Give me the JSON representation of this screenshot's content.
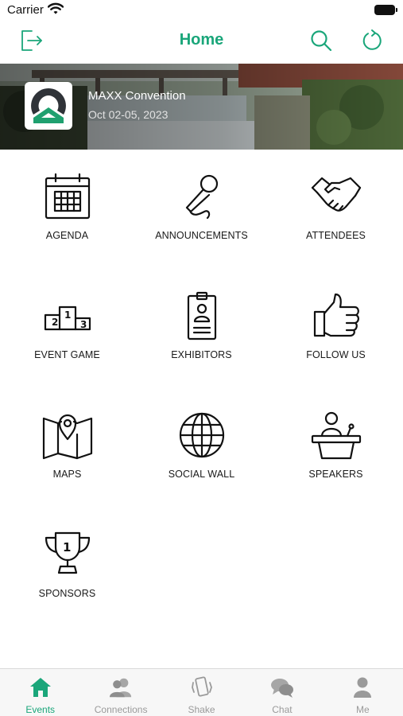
{
  "status_bar": {
    "carrier": "Carrier"
  },
  "nav": {
    "title": "Home"
  },
  "event": {
    "name": "MAXX Convention",
    "dates": "Oct 02-05, 2023"
  },
  "menu": [
    {
      "label": "AGENDA",
      "icon": "calendar-icon"
    },
    {
      "label": "ANNOUNCEMENTS",
      "icon": "microphone-icon"
    },
    {
      "label": "ATTENDEES",
      "icon": "handshake-icon"
    },
    {
      "label": "EVENT GAME",
      "icon": "podium-icon"
    },
    {
      "label": "EXHIBITORS",
      "icon": "badge-icon"
    },
    {
      "label": "FOLLOW US",
      "icon": "thumbs-up-icon"
    },
    {
      "label": "MAPS",
      "icon": "map-pin-icon"
    },
    {
      "label": "SOCIAL WALL",
      "icon": "globe-icon"
    },
    {
      "label": "SPEAKERS",
      "icon": "lectern-icon"
    },
    {
      "label": "SPONSORS",
      "icon": "trophy-icon"
    }
  ],
  "tabs": [
    {
      "label": "Events",
      "icon": "home-icon",
      "active": true
    },
    {
      "label": "Connections",
      "icon": "people-icon",
      "active": false
    },
    {
      "label": "Shake",
      "icon": "shake-phone-icon",
      "active": false
    },
    {
      "label": "Chat",
      "icon": "chat-bubbles-icon",
      "active": false
    },
    {
      "label": "Me",
      "icon": "person-icon",
      "active": false
    }
  ],
  "colors": {
    "accent": "#1aa67a",
    "inactive_tab": "#9a9a9a",
    "icon_stroke": "#111111"
  }
}
